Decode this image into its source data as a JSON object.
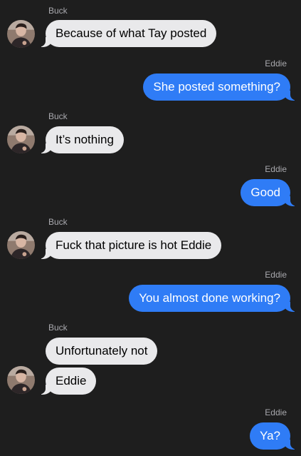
{
  "colors": {
    "background": "#1e1e1e",
    "incoming_bubble": "#e9e9eb",
    "outgoing_bubble": "#2f7cf6",
    "sender_label": "#a9a9ae"
  },
  "contact": {
    "avatar_icon": "profile-photo"
  },
  "messages": [
    {
      "sender": "Buck",
      "direction": "incoming",
      "text": "Because of what Tay posted"
    },
    {
      "sender": "Eddie",
      "direction": "outgoing",
      "text": "She posted something?"
    },
    {
      "sender": "Buck",
      "direction": "incoming",
      "text": "It’s nothing"
    },
    {
      "sender": "Eddie",
      "direction": "outgoing",
      "text": "Good"
    },
    {
      "sender": "Buck",
      "direction": "incoming",
      "text": "Fuck that picture is hot Eddie"
    },
    {
      "sender": "Eddie",
      "direction": "outgoing",
      "text": "You almost done working?"
    },
    {
      "sender": "Buck",
      "direction": "incoming",
      "text": "Unfortunately not"
    },
    {
      "sender": "Buck",
      "direction": "incoming",
      "text": "Eddie"
    },
    {
      "sender": "Eddie",
      "direction": "outgoing",
      "text": "Ya?"
    }
  ]
}
